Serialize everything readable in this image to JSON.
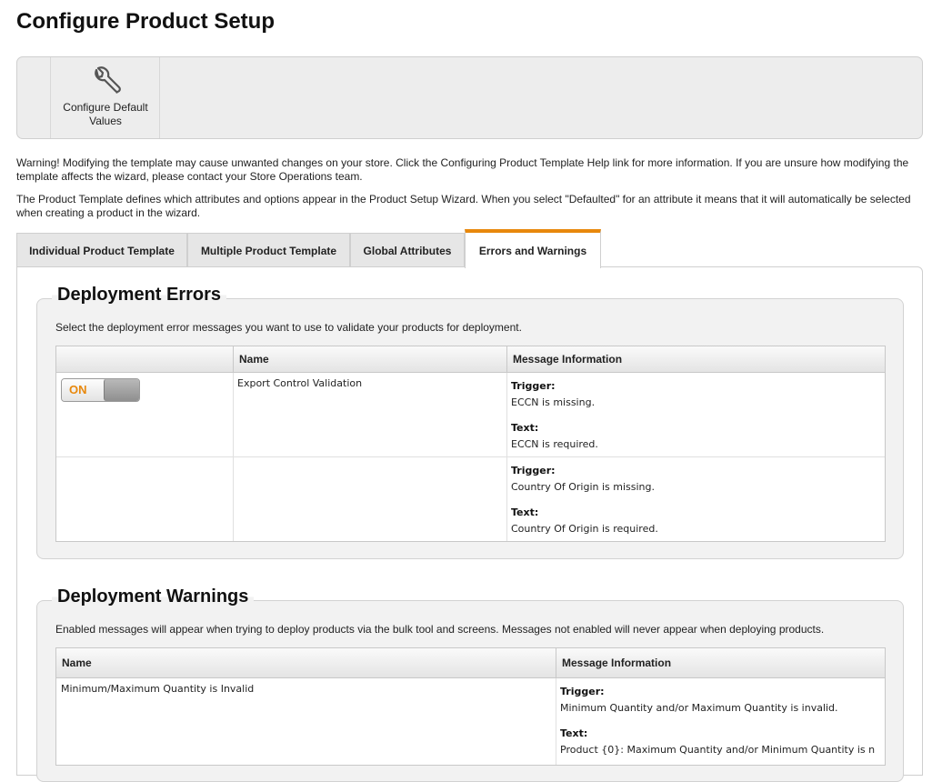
{
  "page": {
    "title": "Configure Product Setup"
  },
  "toolbar": {
    "configure_default_values_label": "Configure Default Values",
    "icon": "wrench-icon"
  },
  "notices": {
    "warning": "Warning! Modifying the template may cause unwanted changes on your store. Click the Configuring Product Template Help link for more information. If you are unsure how modifying the template affects the wizard, please contact your Store Operations team.",
    "info": "The Product Template defines which attributes and options appear in the Product Setup Wizard. When you select \"Defaulted\" for an attribute it means that it will automatically be selected when creating a product in the wizard."
  },
  "tabs": [
    {
      "label": "Individual Product Template",
      "active": false
    },
    {
      "label": "Multiple Product Template",
      "active": false
    },
    {
      "label": "Global Attributes",
      "active": false
    },
    {
      "label": "Errors and Warnings",
      "active": true
    }
  ],
  "accent_color": "#e8880c",
  "errors": {
    "title": "Deployment Errors",
    "description": "Select the deployment error messages you want to use to validate your products for deployment.",
    "columns": [
      "",
      "Name",
      "Message Information"
    ],
    "rows": [
      {
        "toggle": "ON",
        "name": "Export Control Validation",
        "messages": [
          {
            "trigger_label": "Trigger:",
            "trigger": "ECCN is missing.",
            "text_label": "Text:",
            "text": "ECCN is required."
          },
          {
            "trigger_label": "Trigger:",
            "trigger": "Country Of Origin is missing.",
            "text_label": "Text:",
            "text": "Country Of Origin is required."
          }
        ]
      }
    ]
  },
  "warnings": {
    "title": "Deployment Warnings",
    "description": "Enabled messages will appear when trying to deploy products via the bulk tool and screens. Messages not enabled will never appear when deploying products.",
    "columns": [
      "Name",
      "Message Information"
    ],
    "rows": [
      {
        "name": "Minimum/Maximum Quantity is Invalid",
        "trigger_label": "Trigger:",
        "trigger": "Minimum Quantity and/or Maximum Quantity is invalid.",
        "text_label": "Text:",
        "text": "Product {0}: Maximum Quantity and/or Minimum Quantity is n"
      }
    ]
  }
}
